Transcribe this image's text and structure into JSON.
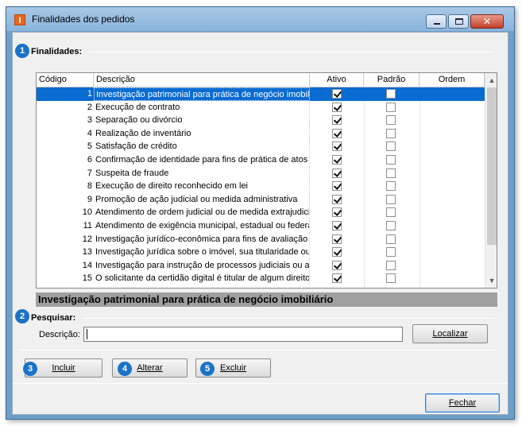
{
  "window": {
    "title": "Finalidades dos pedidos",
    "app_icon_letter": "I",
    "close_glyph": "✕"
  },
  "sections": {
    "finalidades": {
      "badge": "1",
      "label": "Finalidades:"
    },
    "pesquisar": {
      "badge": "2",
      "label": "Pesquisar:"
    }
  },
  "grid": {
    "columns": [
      "Código",
      "Descrição",
      "Ativo",
      "Padrão",
      "Ordem"
    ],
    "selected_row": 0,
    "rows": [
      {
        "codigo": "1",
        "descricao": "Investigação patrimonial para prática de negócio imobiliário",
        "ativo": true,
        "padrao": false
      },
      {
        "codigo": "2",
        "descricao": "Execução de contrato",
        "ativo": true,
        "padrao": false
      },
      {
        "codigo": "3",
        "descricao": "Separação ou divórcio",
        "ativo": true,
        "padrao": false
      },
      {
        "codigo": "4",
        "descricao": "Realização de inventário",
        "ativo": true,
        "padrao": false
      },
      {
        "codigo": "5",
        "descricao": "Satisfação de crédito",
        "ativo": true,
        "padrao": false
      },
      {
        "codigo": "6",
        "descricao": "Confirmação de identidade para fins de prática de atos l",
        "ativo": true,
        "padrao": false
      },
      {
        "codigo": "7",
        "descricao": "Suspeita de fraude",
        "ativo": true,
        "padrao": false
      },
      {
        "codigo": "8",
        "descricao": "Execução de direito reconhecido em lei",
        "ativo": true,
        "padrao": false
      },
      {
        "codigo": "9",
        "descricao": "Promoção de ação judicial ou medida administrativa",
        "ativo": true,
        "padrao": false
      },
      {
        "codigo": "10",
        "descricao": "Atendimento de ordem judicial ou de medida extrajudicia",
        "ativo": true,
        "padrao": false
      },
      {
        "codigo": "11",
        "descricao": "Atendimento de exigência municipal, estadual ou federa",
        "ativo": true,
        "padrao": false
      },
      {
        "codigo": "12",
        "descricao": "Investigação jurídico-econômica para fins de avaliação c",
        "ativo": true,
        "padrao": false
      },
      {
        "codigo": "13",
        "descricao": "Investigação jurídica sobre o imóvel, sua titularidade ou",
        "ativo": true,
        "padrao": false
      },
      {
        "codigo": "14",
        "descricao": "Investigação para instrução de processos judiciais ou ac",
        "ativo": true,
        "padrao": false
      },
      {
        "codigo": "15",
        "descricao": "O solicitante da certidão digital é titular de algum direito",
        "ativo": true,
        "padrao": false
      }
    ]
  },
  "selected_description": "Investigação patrimonial para prática de negócio imobiliário",
  "search": {
    "label": "Descrição:",
    "value": "",
    "placeholder": "",
    "localizar_label": "Localizar"
  },
  "actions": {
    "incluir": {
      "badge": "3",
      "label": "Incluir"
    },
    "alterar": {
      "badge": "4",
      "label": "Alterar"
    },
    "excluir": {
      "badge": "5",
      "label": "Excluir"
    },
    "fechar": {
      "label": "Fechar"
    }
  },
  "colors": {
    "selection": "#0a6bd1",
    "badge": "#1a73c8",
    "title_bar": "#a9c8e6"
  }
}
